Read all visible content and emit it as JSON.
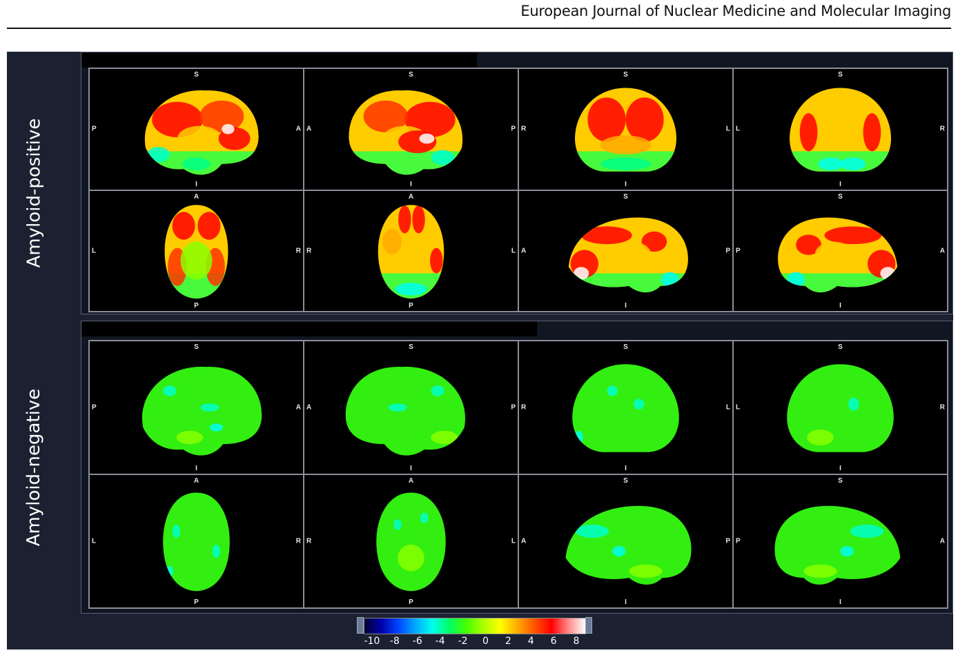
{
  "header": {
    "journal": "European Journal of Nuclear Medicine and Molecular Imaging"
  },
  "rows": [
    {
      "label": "Amyloid-positive",
      "status": "positive",
      "views": [
        {
          "view": "lateral-left",
          "top": "S",
          "bottom": "I",
          "left": "P",
          "right": "A"
        },
        {
          "view": "lateral-right",
          "top": "S",
          "bottom": "I",
          "left": "A",
          "right": "P"
        },
        {
          "view": "anterior",
          "top": "S",
          "bottom": "I",
          "left": "R",
          "right": "L"
        },
        {
          "view": "posterior",
          "top": "S",
          "bottom": "I",
          "left": "L",
          "right": "R"
        },
        {
          "view": "superior",
          "top": "A",
          "bottom": "P",
          "left": "L",
          "right": "R"
        },
        {
          "view": "inferior",
          "top": "A",
          "bottom": "P",
          "left": "R",
          "right": "L"
        },
        {
          "view": "medial-left",
          "top": "S",
          "bottom": "I",
          "left": "A",
          "right": "P"
        },
        {
          "view": "medial-right",
          "top": "S",
          "bottom": "I",
          "left": "P",
          "right": "A"
        }
      ]
    },
    {
      "label": "Amyloid-negative",
      "status": "negative",
      "views": [
        {
          "view": "lateral-left",
          "top": "S",
          "bottom": "I",
          "left": "P",
          "right": "A"
        },
        {
          "view": "lateral-right",
          "top": "S",
          "bottom": "I",
          "left": "A",
          "right": "P"
        },
        {
          "view": "anterior",
          "top": "S",
          "bottom": "I",
          "left": "R",
          "right": "L"
        },
        {
          "view": "posterior",
          "top": "S",
          "bottom": "I",
          "left": "L",
          "right": "R"
        },
        {
          "view": "superior",
          "top": "A",
          "bottom": "P",
          "left": "L",
          "right": "R"
        },
        {
          "view": "inferior",
          "top": "A",
          "bottom": "P",
          "left": "R",
          "right": "L"
        },
        {
          "view": "medial-left",
          "top": "S",
          "bottom": "I",
          "left": "A",
          "right": "P"
        },
        {
          "view": "medial-right",
          "top": "S",
          "bottom": "I",
          "left": "P",
          "right": "A"
        }
      ]
    }
  ],
  "colorbar": {
    "min": -10,
    "max": 8,
    "ticks": [
      "-10",
      "-8",
      "-6",
      "-4",
      "-2",
      "0",
      "2",
      "4",
      "6",
      "8"
    ],
    "colors": [
      "#000033",
      "#0000aa",
      "#0044ff",
      "#00aaff",
      "#00ffee",
      "#00ff66",
      "#44ff00",
      "#aaff00",
      "#ffff00",
      "#ffaa00",
      "#ff5500",
      "#ff0000",
      "#ff8888",
      "#ffffff"
    ]
  }
}
